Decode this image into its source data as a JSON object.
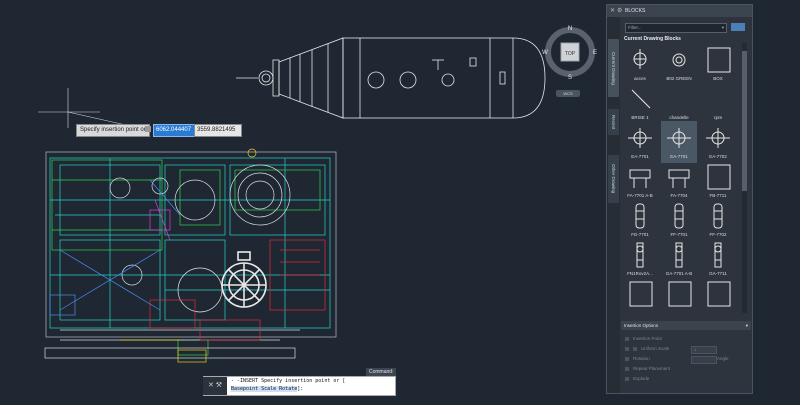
{
  "canvas": {
    "tooltip": "Specify insertion point or",
    "dyn_x": "6062.044407",
    "dyn_y": "3559.8821495",
    "wcs": "WCS"
  },
  "viewcube": {
    "n": "N",
    "s": "S",
    "e": "E",
    "w": "W",
    "top": "TOP"
  },
  "command": {
    "label": "Command:",
    "line1": "- -INSERT Specify insertion point or [",
    "line2_options": "Basepoint Scale Rotate",
    "line2_end": "]:"
  },
  "palette": {
    "title": "BLOCKS",
    "filter_placeholder": "Filter...",
    "section_title": "Current Drawing Blocks",
    "tabs": [
      "Current Drawing",
      "Recent",
      "Other Drawing"
    ],
    "blocks": [
      {
        "label": "acces",
        "icon": "valve-icon"
      },
      {
        "label": "B02 GREEN",
        "icon": "circle-icon"
      },
      {
        "label": "BOX",
        "icon": "box-icon"
      },
      {
        "label": "BRISE 1",
        "icon": "line-icon"
      },
      {
        "label": "chandelle",
        "icon": "blank-icon"
      },
      {
        "label": "cpm",
        "icon": "blank-icon"
      },
      {
        "label": "EA-7701",
        "icon": "pump-icon"
      },
      {
        "label": "EA-7701",
        "icon": "pump-icon",
        "selected": true
      },
      {
        "label": "EA-7702",
        "icon": "pump-icon"
      },
      {
        "label": "FA-7701 A-B",
        "icon": "tank-icon"
      },
      {
        "label": "FA-7704",
        "icon": "tank-icon"
      },
      {
        "label": "FB-7711",
        "icon": "box-icon"
      },
      {
        "label": "FD-7701",
        "icon": "column-icon"
      },
      {
        "label": "FF-7701",
        "icon": "column-icon"
      },
      {
        "label": "FF-7702",
        "icon": "column-icon"
      },
      {
        "label": "FN1Rov2A...",
        "icon": "motor-icon"
      },
      {
        "label": "GA-7701 A-B",
        "icon": "motor-icon"
      },
      {
        "label": "GA-7711",
        "icon": "motor-icon"
      },
      {
        "label": "",
        "icon": "box-icon"
      },
      {
        "label": "",
        "icon": "box-icon"
      },
      {
        "label": "",
        "icon": "box-icon"
      }
    ],
    "insertion": {
      "title": "Insertion Options",
      "insertion_point": "Insertion Point",
      "uniform_scale": "Uniform Scale",
      "rotation": "Rotation",
      "angle_label": "Angle",
      "repeat": "Repeat Placement",
      "explode": "Explode",
      "scale_value": "1"
    }
  }
}
